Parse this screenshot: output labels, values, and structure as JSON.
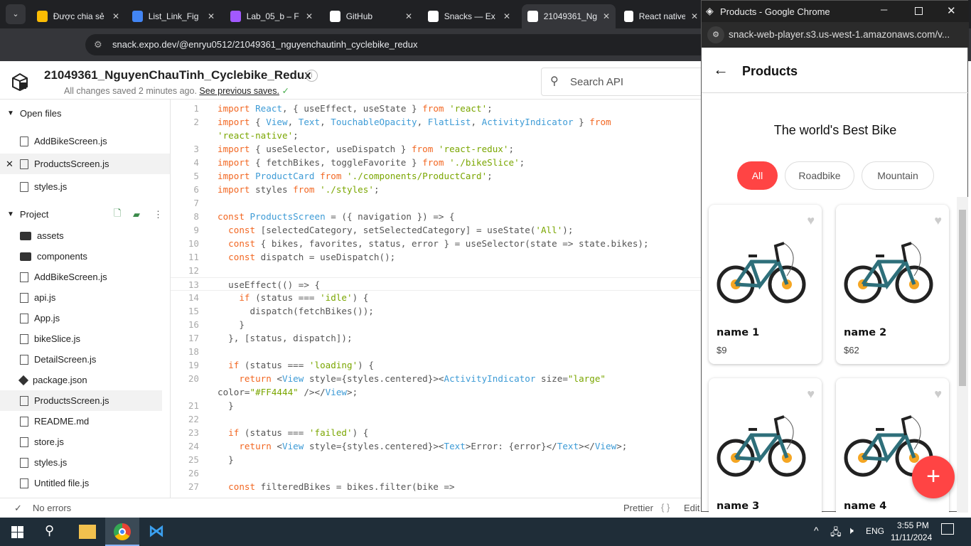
{
  "browser": {
    "tabs": [
      {
        "title": "Được chia sẻ",
        "color": "#fbbc04"
      },
      {
        "title": "List_Link_Fig",
        "color": "#4285f4"
      },
      {
        "title": "Lab_05_b – F",
        "color": "#a259ff"
      },
      {
        "title": "GitHub",
        "color": "#ffffff"
      },
      {
        "title": "Snacks — Ex",
        "color": "#ffffff"
      },
      {
        "title": "21049361_Ng",
        "color": "#ffffff"
      },
      {
        "title": "React native",
        "color": "#ffffff"
      }
    ],
    "url": "snack.expo.dev/@enryu0512/21049361_nguyenchautinh_cyclebike_redux"
  },
  "snack": {
    "project_title": "21049361_NguyenChauTinh_Cyclebike_Redux",
    "save_status": "All changes saved 2 minutes ago.",
    "previous_saves_link": "See previous saves.",
    "search_placeholder": "Search API"
  },
  "sidebar": {
    "open_files_label": "Open files",
    "open_files": [
      "AddBikeScreen.js",
      "ProductsScreen.js",
      "styles.js"
    ],
    "project_label": "Project",
    "project_files": [
      {
        "name": "assets",
        "type": "folder"
      },
      {
        "name": "components",
        "type": "folder"
      },
      {
        "name": "AddBikeScreen.js",
        "type": "file"
      },
      {
        "name": "api.js",
        "type": "file"
      },
      {
        "name": "App.js",
        "type": "file"
      },
      {
        "name": "bikeSlice.js",
        "type": "file"
      },
      {
        "name": "DetailScreen.js",
        "type": "file"
      },
      {
        "name": "package.json",
        "type": "package"
      },
      {
        "name": "ProductsScreen.js",
        "type": "file",
        "selected": true
      },
      {
        "name": "README.md",
        "type": "file"
      },
      {
        "name": "store.js",
        "type": "file"
      },
      {
        "name": "styles.js",
        "type": "file"
      },
      {
        "name": "Untitled file.js",
        "type": "file"
      }
    ]
  },
  "editor": {
    "lines": [
      {
        "n": "1",
        "text": "import React, { useEffect, useState } from 'react';"
      },
      {
        "n": "2",
        "text": "import { View, Text, TouchableOpacity, FlatList, ActivityIndicator } from"
      },
      {
        "n": "",
        "text": "'react-native';"
      },
      {
        "n": "3",
        "text": "import { useSelector, useDispatch } from 'react-redux';"
      },
      {
        "n": "4",
        "text": "import { fetchBikes, toggleFavorite } from './bikeSlice';"
      },
      {
        "n": "5",
        "text": "import ProductCard from './components/ProductCard';"
      },
      {
        "n": "6",
        "text": "import styles from './styles';"
      },
      {
        "n": "7",
        "text": ""
      },
      {
        "n": "8",
        "text": "const ProductsScreen = ({ navigation }) => {"
      },
      {
        "n": "9",
        "text": "  const [selectedCategory, setSelectedCategory] = useState('All');"
      },
      {
        "n": "10",
        "text": "  const { bikes, favorites, status, error } = useSelector(state => state.bikes);"
      },
      {
        "n": "11",
        "text": "  const dispatch = useDispatch();"
      },
      {
        "n": "12",
        "text": ""
      },
      {
        "n": "13",
        "text": "  useEffect(() => {",
        "current": true
      },
      {
        "n": "14",
        "text": "    if (status === 'idle') {"
      },
      {
        "n": "15",
        "text": "      dispatch(fetchBikes());"
      },
      {
        "n": "16",
        "text": "    }"
      },
      {
        "n": "17",
        "text": "  }, [status, dispatch]);"
      },
      {
        "n": "18",
        "text": ""
      },
      {
        "n": "19",
        "text": "  if (status === 'loading') {"
      },
      {
        "n": "20",
        "text": "    return <View style={styles.centered}><ActivityIndicator size=\"large\""
      },
      {
        "n": "",
        "text": "color=\"#FF4444\" /></View>;",
        "nowrapindent": true
      },
      {
        "n": "21",
        "text": "  }"
      },
      {
        "n": "22",
        "text": ""
      },
      {
        "n": "23",
        "text": "  if (status === 'failed') {"
      },
      {
        "n": "24",
        "text": "    return <View style={styles.centered}><Text>Error: {error}</Text></View>;"
      },
      {
        "n": "25",
        "text": "  }"
      },
      {
        "n": "26",
        "text": ""
      },
      {
        "n": "27",
        "text": "  const filteredBikes = bikes.filter(bike =>"
      }
    ]
  },
  "statusbar": {
    "errors": "No errors",
    "prettier": "Prettier",
    "braces": "{ }",
    "editor": "Edit"
  },
  "preview": {
    "window_title": "Products - Google Chrome",
    "url": "snack-web-player.s3.us-west-1.amazonaws.com/v...",
    "header_title": "Products",
    "headline": "The world's Best Bike",
    "categories": [
      {
        "label": "All",
        "active": true
      },
      {
        "label": "Roadbike"
      },
      {
        "label": "Mountain"
      }
    ],
    "accent": "#ff4444",
    "products": [
      {
        "name": "name 1",
        "price": "$9"
      },
      {
        "name": "name 2",
        "price": "$62"
      },
      {
        "name": "name 3",
        "price": ""
      },
      {
        "name": "name 4",
        "price": ""
      }
    ],
    "fab": "+"
  },
  "taskbar": {
    "lang": "ENG",
    "time": "3:55 PM",
    "date": "11/11/2024"
  }
}
